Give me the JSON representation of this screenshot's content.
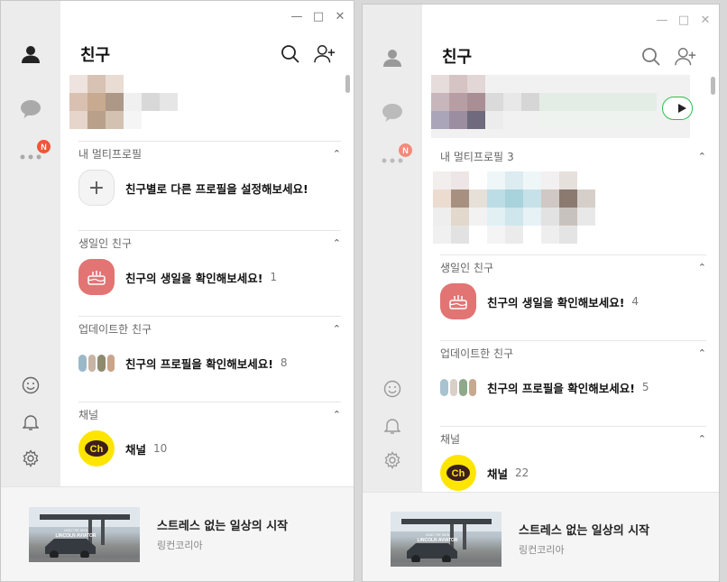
{
  "left": {
    "title": "친구",
    "badge": "N",
    "sections": {
      "multiprofile": {
        "header": "내 멀티프로필",
        "label": "친구별로 다른 프로필을 설정해보세요!",
        "plus": "+"
      },
      "birthday": {
        "header": "생일인 친구",
        "label": "친구의 생일을 확인해보세요!",
        "count": "1"
      },
      "updated": {
        "header": "업데이트한 친구",
        "label": "친구의 프로필을 확인해보세요!",
        "count": "8"
      },
      "channel": {
        "header": "채널",
        "label": "채널",
        "count": "10"
      }
    },
    "ad": {
      "title": "스트레스 없는 일상의 시작",
      "sub": "링컨코리아",
      "brand": "LINCOLN AVIATOR",
      "tagline": "LEAD THE SIGN"
    }
  },
  "right": {
    "title": "친구",
    "badge": "N",
    "sections": {
      "multiprofile": {
        "header": "내 멀티프로필",
        "count": "3"
      },
      "birthday": {
        "header": "생일인 친구",
        "label": "친구의 생일을 확인해보세요!",
        "count": "4"
      },
      "updated": {
        "header": "업데이트한 친구",
        "label": "친구의 프로필을 확인해보세요!",
        "count": "5"
      },
      "channel": {
        "header": "채널",
        "label": "채널",
        "count": "22"
      }
    },
    "ad": {
      "title": "스트레스 없는 일상의 시작",
      "sub": "링컨코리아",
      "brand": "LINCOLN AVIATOR",
      "tagline": "LEAD THE SIGN"
    }
  },
  "icons": {
    "friends": "person-icon",
    "chat": "chat-bubble-icon",
    "more": "more-dots-icon",
    "emoji": "emoji-icon",
    "bell": "bell-icon",
    "settings": "gear-icon",
    "search": "search-icon",
    "add_friend": "add-friend-icon"
  },
  "colors": {
    "badge": "#f0543c",
    "birthday": "#e27474",
    "channel": "#fee500",
    "play_border": "#2fbf4f"
  }
}
